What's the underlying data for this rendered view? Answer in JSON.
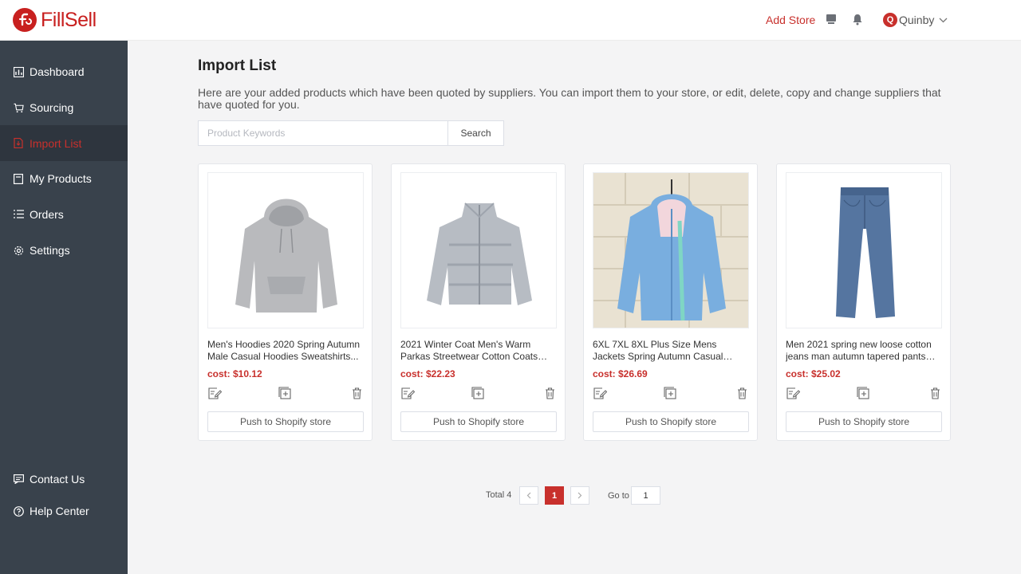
{
  "app": {
    "logo_text": "FillSell"
  },
  "header": {
    "add_store": "Add Store",
    "user_initial": "Q",
    "user_name": "Quinby"
  },
  "sidebar": {
    "items": [
      {
        "label": "Dashboard",
        "icon": "dashboard-icon"
      },
      {
        "label": "Sourcing",
        "icon": "cart-icon"
      },
      {
        "label": "Import List",
        "icon": "import-icon",
        "active": true
      },
      {
        "label": "My Products",
        "icon": "products-icon"
      },
      {
        "label": "Orders",
        "icon": "list-icon"
      },
      {
        "label": "Settings",
        "icon": "gear-icon"
      }
    ],
    "bottom": [
      {
        "label": "Contact Us",
        "icon": "message-icon"
      },
      {
        "label": "Help Center",
        "icon": "help-icon"
      }
    ]
  },
  "main": {
    "title": "Import List",
    "description": "Here are your added products which have been quoted by suppliers. You can import them to your store, or edit, delete, copy and change suppliers that have quoted for you.",
    "search": {
      "placeholder": "Product Keywords",
      "value": "",
      "button": "Search"
    },
    "products": [
      {
        "title": "Men's Hoodies 2020 Spring Autumn Male Casual Hoodies Sweatshirts...",
        "cost": "cost: $10.12",
        "push": "Push to Shopify store",
        "image": "grey-hoodie"
      },
      {
        "title": "2021 Winter Coat Men's Warm Parkas Streetwear Cotton Coats Slim Male...",
        "cost": "cost: $22.23",
        "push": "Push to Shopify store",
        "image": "grey-puffer-jacket"
      },
      {
        "title": "6XL 7XL 8XL Plus Size Mens Jackets Spring Autumn Casual Fashion...",
        "cost": "cost: $26.69",
        "push": "Push to Shopify store",
        "image": "blue-hooded-jacket"
      },
      {
        "title": "Men 2021 spring new loose cotton jeans man autumn tapered pants tre...",
        "cost": "cost: $25.02",
        "push": "Push to Shopify store",
        "image": "blue-jeans"
      }
    ]
  },
  "pagination": {
    "total": "Total 4",
    "current_page": "1",
    "goto_label": "Go to",
    "goto_value": "1"
  },
  "colors": {
    "brand": "#c8201f",
    "accent": "#c8302c",
    "sidebar_bg": "#39424c",
    "sidebar_active_bg": "#2e353e"
  }
}
